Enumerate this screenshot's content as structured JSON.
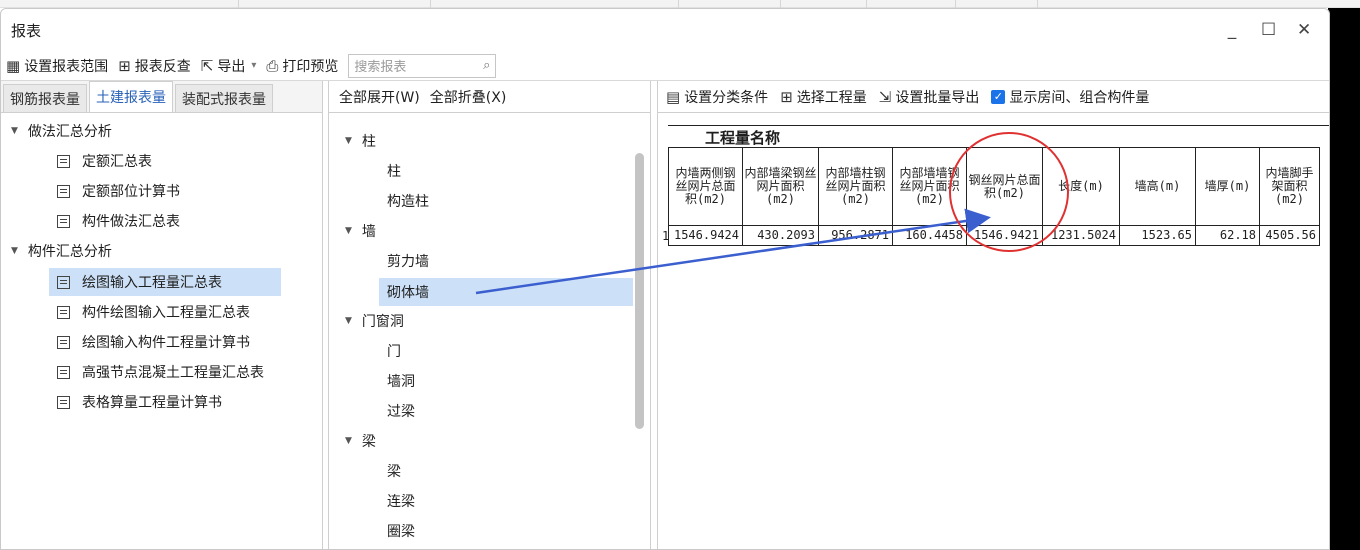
{
  "window": {
    "title": "报表",
    "controls": {
      "minimize": "_",
      "maximize": "☐",
      "close": "✕"
    }
  },
  "toolbar": {
    "set_range": "设置报表范围",
    "reverse_check": "报表反查",
    "export": "导出",
    "export_caret": "▾",
    "print_preview": "打印预览",
    "search_placeholder": "搜索报表"
  },
  "tabs": [
    "钢筋报表量",
    "土建报表量",
    "装配式报表量"
  ],
  "tree": {
    "group1": "做法汇总分析",
    "group1_items": [
      "定额汇总表",
      "定额部位计算书",
      "构件做法汇总表"
    ],
    "group2": "构件汇总分析",
    "group2_items": [
      "绘图输入工程量汇总表",
      "构件绘图输入工程量汇总表",
      "绘图输入构件工程量计算书",
      "高强节点混凝土工程量汇总表",
      "表格算量工程量计算书"
    ]
  },
  "middle": {
    "expand_all": "全部展开(W)",
    "collapse_all": "全部折叠(X)",
    "groups": [
      {
        "label": "柱",
        "items": [
          "柱",
          "构造柱"
        ]
      },
      {
        "label": "墙",
        "items": [
          "剪力墙",
          "砌体墙"
        ]
      },
      {
        "label": "门窗洞",
        "items": [
          "门",
          "墙洞",
          "过梁"
        ]
      },
      {
        "label": "梁",
        "items": [
          "梁",
          "连梁",
          "圈梁"
        ]
      }
    ]
  },
  "right": {
    "set_category": "设置分类条件",
    "select_quantity": "选择工程量",
    "batch_export": "设置批量导出",
    "show_rooms": "显示房间、组合构件量",
    "report_title": "工程量名称",
    "columns": [
      "内墙两侧钢丝网片总面积(m2)",
      "内部墙梁钢丝网片面积(m2)",
      "内部墙柱钢丝网片面积(m2)",
      "内部墙墙钢丝网片面积(m2)",
      "钢丝网片总面积(m2)",
      "长度(m)",
      "墙高(m)",
      "墙厚(m)",
      "内墙脚手架面积(m2)"
    ],
    "row_number": "1",
    "row": [
      "1546.9424",
      "430.2093",
      "956.2871",
      "160.4458",
      "1546.9421",
      "1231.5024",
      "1523.65",
      "62.18",
      "4505.56"
    ]
  },
  "icons": [
    "grid-icon",
    "reverse-icon",
    "export-icon",
    "print-preview-icon",
    "search-icon",
    "category-icon",
    "select-icon",
    "batch-export-icon",
    "checkbox-icon"
  ],
  "colors": {
    "accent": "#1a73e8",
    "selection": "#cce0f7",
    "annotation_circle": "#e03131",
    "annotation_arrow": "#3b5fcf"
  }
}
